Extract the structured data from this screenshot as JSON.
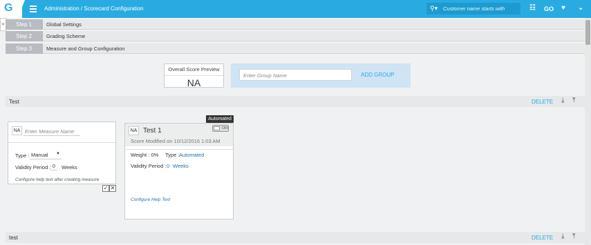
{
  "app": {
    "logo": "G",
    "breadcrumb": "Administration / Scorecard Configuration"
  },
  "search": {
    "placeholder": "Customer name starts with",
    "icon": "search-icon"
  },
  "toolbar_icons": [
    "hierarchy-icon",
    "go-icon",
    "bell-icon",
    "double-chevron-down-icon"
  ],
  "go_label": "GO",
  "steps": [
    {
      "num": "Step 1",
      "label": "Global Settings"
    },
    {
      "num": "Step 2",
      "label": "Grading Scheme"
    },
    {
      "num": "Step 3",
      "label": "Measure and Group Configuration"
    }
  ],
  "preview": {
    "label": "Overall Score Preview",
    "value": "NA"
  },
  "add_group": {
    "placeholder": "Enter Group Name",
    "button": "ADD GROUP"
  },
  "groups": [
    {
      "name": "Test",
      "delete": "DELETE"
    },
    {
      "name": "test",
      "delete": "DELETE"
    }
  ],
  "new_measure": {
    "na": "NA",
    "placeholder": "Enter Measure Name",
    "type_label": "Type :",
    "type_value": "Manual",
    "validity_label": "Validity Period :",
    "validity_value": "0",
    "validity_unit": "Weeks",
    "help_hint": "Configure help text after creating measure"
  },
  "card": {
    "na": "NA",
    "title": "Test 1",
    "modified": "Score Modified on 10/12/2016 1:03 AM",
    "weight": "Weight : 0%",
    "type_label": "Type :",
    "type_value": "Automated",
    "validity_label": "Validity Period :",
    "validity_value": "0",
    "validity_unit": "Weeks",
    "help_link": "Configure Help Text",
    "tooltip": "Automated",
    "toggle_text": "OFF"
  },
  "colors": {
    "brand": "#29abe2",
    "link": "#1f6fb0"
  }
}
